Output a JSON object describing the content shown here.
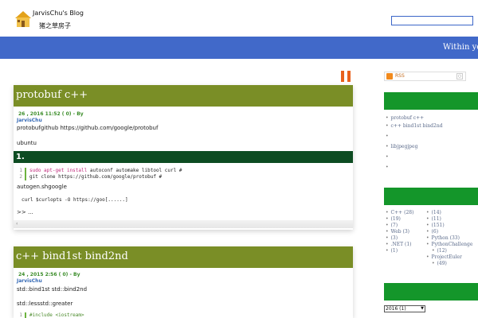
{
  "header": {
    "blog_title": "JarvisChu's Blog",
    "blog_subtitle": "猪之草房子",
    "search_placeholder": ""
  },
  "banner": {
    "text": "Within you"
  },
  "posts": [
    {
      "title": "protobuf c++",
      "meta": "26 , 2016  11:52          (    0) - By",
      "author": "JarvisChu",
      "line1": "protobufgithub  https://github.com/google/protobuf",
      "line2": "ubuntu",
      "section": "1.",
      "code": [
        {
          "n": "1",
          "kw": "sudo apt-get install",
          "rest": " autoconf automake libtool curl #"
        },
        {
          "n": "2",
          "kw": "",
          "rest": "git clone https://github.com/google/protobuf #"
        }
      ],
      "line3": "autogen.shgoogle",
      "code2": "curl $curlopts -O https://goo[......]",
      "more": ">> ..."
    },
    {
      "title": "c++ bind1st  bind2nd",
      "meta": "24 , 2015  2:56          (    0) - By",
      "author": "JarvisChu",
      "line1": "std::bind1st  std::bind2nd",
      "line2": "std::lessstd::greater",
      "code": [
        {
          "n": "1",
          "kw": "",
          "rest": "#include <iostream>"
        }
      ]
    }
  ],
  "sidebar": {
    "rss_label": "RSS",
    "recent": [
      "protobuf c++",
      "c++ bind1st  bind2nd",
      "",
      "libjpegjpeg",
      "",
      ""
    ],
    "categories_left": [
      "C++ (28)",
      "(19)",
      "(7)",
      "Web (3)",
      "(3)",
      ".NET (1)",
      "(1)"
    ],
    "categories_right": [
      "(14)",
      "(11)",
      "(151)",
      "(6)",
      "Python (33)",
      "PythonChallenge",
      "(12)",
      "ProjectEuler",
      "(49)"
    ],
    "archive_value": "2016  (1)"
  },
  "colors": {
    "banner": "#4169c9",
    "post_title_bar": "#7a8e26",
    "section_bar": "#0d4c22",
    "sidebar_green": "#14962a",
    "accent": "#e9601c"
  }
}
